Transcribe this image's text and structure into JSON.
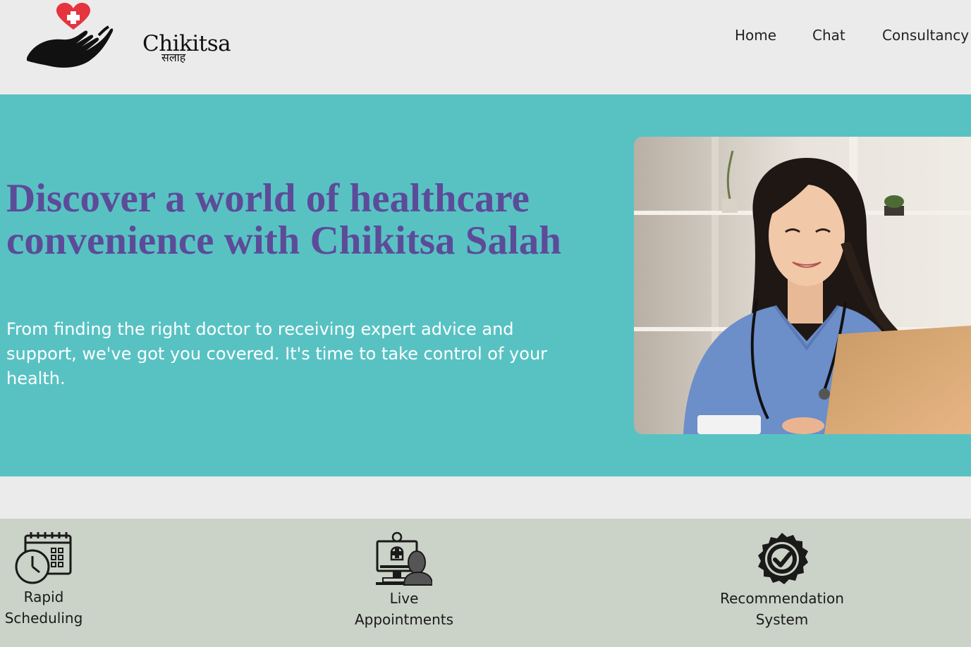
{
  "header": {
    "logo": {
      "name": "Chikitsa",
      "subtitle": "सलाह",
      "icon": "heart-cross-hand-logo"
    },
    "nav": [
      {
        "label": "Home"
      },
      {
        "label": "Chat"
      },
      {
        "label": "Consultancy"
      }
    ]
  },
  "hero": {
    "title": "Discover a world of healthcare convenience with Chikitsa Salah",
    "description": "From finding the right doctor to receiving expert advice and support, we've got you covered. It's time to take control of your health.",
    "image_subject": "smiling doctor in scrubs with stethoscope using a laptop"
  },
  "features": [
    {
      "icon": "calendar-clock-icon",
      "label_line1": "Rapid",
      "label_line2": "Scheduling"
    },
    {
      "icon": "telemedicine-monitor-icon",
      "label_line1": "Live",
      "label_line2": "Appointments"
    },
    {
      "icon": "badge-check-icon",
      "label_line1": "Recommendation",
      "label_line2": "System"
    }
  ],
  "colors": {
    "background": "#ebebeb",
    "hero_background": "#58c2c3",
    "hero_title": "#5c4b99",
    "hero_text": "#ffffff",
    "features_background": "#cbd2c7",
    "logo_heart": "#e5343d"
  }
}
